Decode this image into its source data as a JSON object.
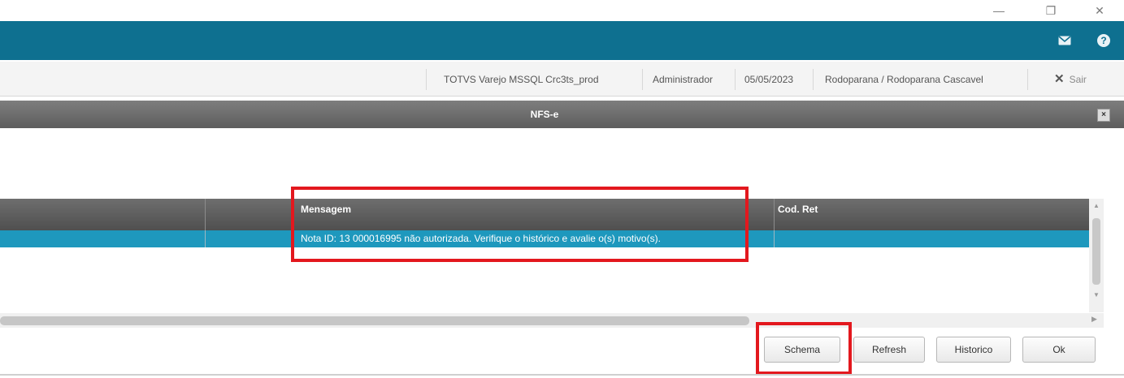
{
  "window_controls": {
    "minimize_glyph": "—",
    "restore_glyph": "❐",
    "close_glyph": "✕"
  },
  "topbar": {
    "color": "#0e7090",
    "icons": [
      "mail-icon",
      "help-icon"
    ]
  },
  "infobar": {
    "environment": "TOTVS Varejo MSSQL Crc3ts_prod",
    "user": "Administrador",
    "date": "05/05/2023",
    "company": "Rodoparana / Rodoparana Cascavel",
    "exit_label": "Sair"
  },
  "dialog": {
    "title": "NFS-e",
    "close_glyph": "×"
  },
  "grid": {
    "columns": [
      "Cod. Ret",
      "Mensagem"
    ],
    "rows": [
      {
        "cod_ret": "",
        "mensagem": "Nota ID: 13 000016995 não autorizada. Verifique o histórico e avalie o(s) motivo(s)."
      }
    ],
    "selected_row_color": "#1e98bd"
  },
  "buttons": {
    "schema": "Schema",
    "refresh": "Refresh",
    "historico": "Historico",
    "ok": "Ok"
  },
  "highlight_color": "#e3181e"
}
